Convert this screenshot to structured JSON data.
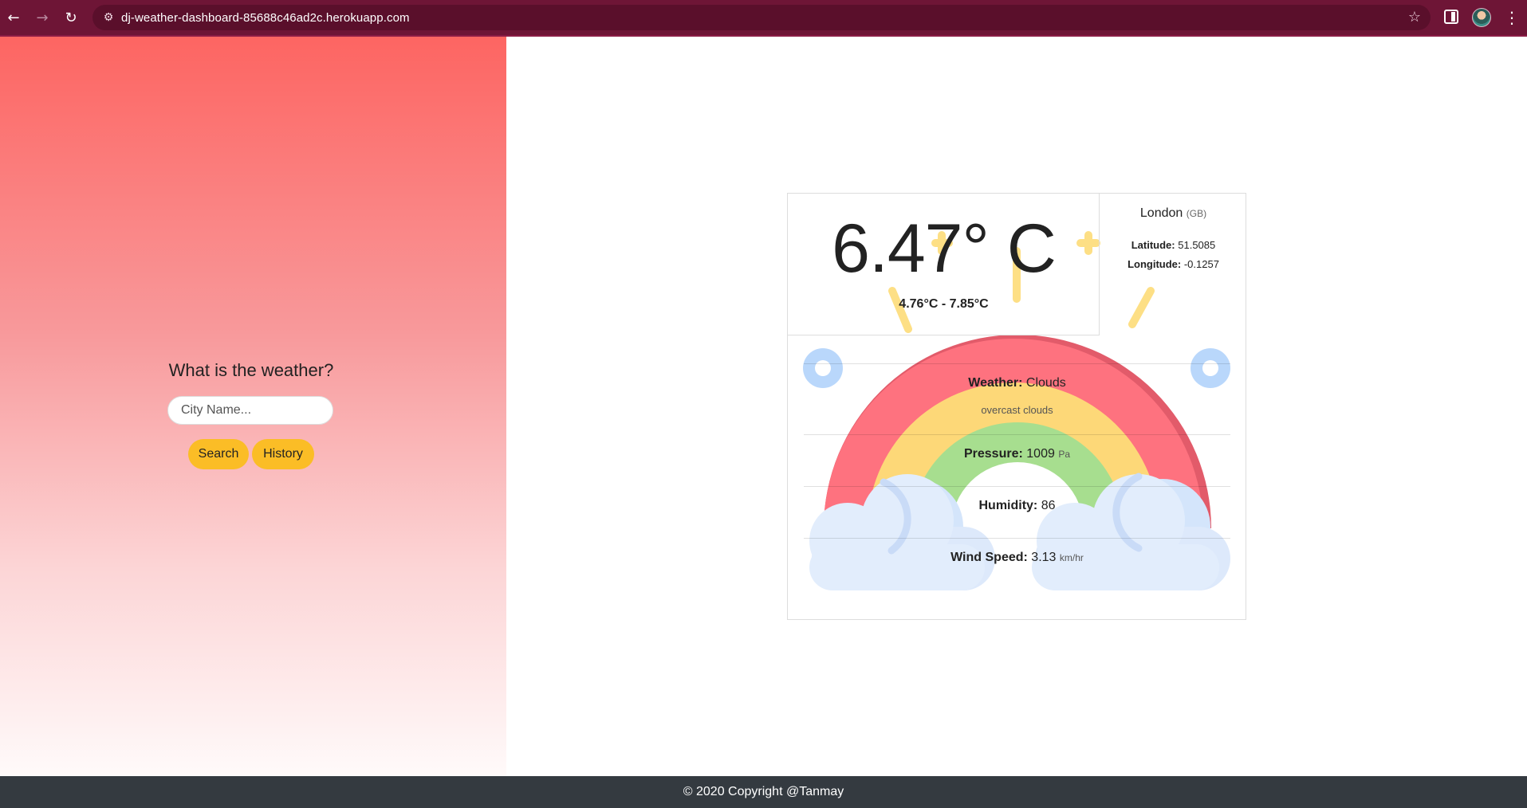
{
  "browser": {
    "url": "dj-weather-dashboard-85688c46ad2c.herokuapp.com",
    "back_icon": "arrow-left",
    "forward_icon": "arrow-right",
    "reload_icon": "reload",
    "bookmark_icon": "star",
    "colors": {
      "bar": "#6e1536",
      "urlbar": "#5a0f2b"
    }
  },
  "search_panel": {
    "title": "What is the weather?",
    "input": {
      "placeholder": "City Name...",
      "value": ""
    },
    "search_label": "Search",
    "history_label": "History",
    "colors": {
      "gradient_top": "#fd6562",
      "button": "#fbbd26"
    }
  },
  "weather": {
    "temperature": "6.47° C",
    "range": "4.76°C - 7.85°C",
    "city": "London",
    "country": "(GB)",
    "latitude_label": "Latitude:",
    "latitude": "51.5085",
    "longitude_label": "Longitude:",
    "longitude": "-0.1257",
    "weather_label": "Weather:",
    "weather": "Clouds",
    "description": "overcast clouds",
    "pressure_label": "Pressure:",
    "pressure": "1009",
    "pressure_unit": "Pa",
    "humidity_label": "Humidity:",
    "humidity": "86",
    "wind_label": "Wind Speed:",
    "wind": "3.13",
    "wind_unit": "km/hr"
  },
  "footer": {
    "text": "© 2020 Copyright @Tanmay"
  }
}
